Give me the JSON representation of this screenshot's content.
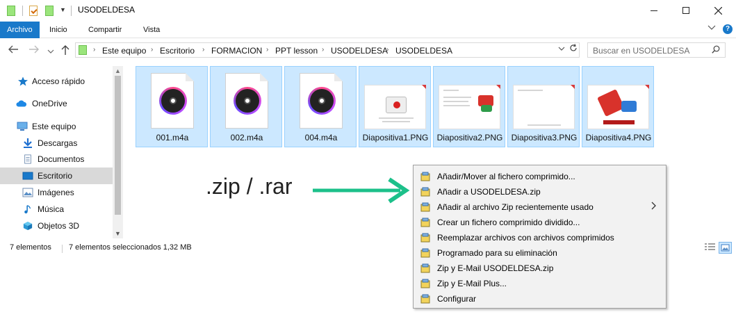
{
  "window": {
    "title": "USODELDESA",
    "quick_access": [
      "folder-icon",
      "properties-icon",
      "new-folder-icon"
    ]
  },
  "ribbon": {
    "tabs": [
      {
        "label": "Archivo",
        "active": true
      },
      {
        "label": "Inicio"
      },
      {
        "label": "Compartir"
      },
      {
        "label": "Vista"
      }
    ]
  },
  "address": {
    "crumbs": [
      "Este equipo",
      "Escritorio",
      "FORMACION",
      "PPT lesson",
      "USODELDESA",
      "USODELDESA"
    ]
  },
  "search": {
    "placeholder": "Buscar en USODELDESA"
  },
  "sidebar": {
    "items": [
      {
        "label": "Acceso rápido",
        "icon": "star-icon"
      },
      {
        "label": "OneDrive",
        "icon": "cloud-icon"
      },
      {
        "label": "Este equipo",
        "icon": "computer-icon"
      },
      {
        "label": "Descargas",
        "icon": "download-icon"
      },
      {
        "label": "Documentos",
        "icon": "documents-icon"
      },
      {
        "label": "Escritorio",
        "icon": "desktop-icon",
        "selected": true
      },
      {
        "label": "Imágenes",
        "icon": "images-icon"
      },
      {
        "label": "Música",
        "icon": "music-icon"
      },
      {
        "label": "Objetos 3D",
        "icon": "cube-icon"
      }
    ]
  },
  "files": [
    {
      "name": "001.m4a",
      "type": "audio"
    },
    {
      "name": "002.m4a",
      "type": "audio"
    },
    {
      "name": "004.m4a",
      "type": "audio"
    },
    {
      "name": "Diapositiva1.PNG",
      "type": "image"
    },
    {
      "name": "Diapositiva2.PNG",
      "type": "image"
    },
    {
      "name": "Diapositiva3.PNG",
      "type": "image"
    },
    {
      "name": "Diapositiva4.PNG",
      "type": "image"
    }
  ],
  "status": {
    "count": "7 elementos",
    "selected": "7 elementos seleccionados  1,32 MB"
  },
  "annotation": {
    "text": ".zip / .rar",
    "arrow_color": "#1cc08a"
  },
  "context_menu": {
    "items": [
      {
        "label": "Añadir/Mover al fichero comprimido..."
      },
      {
        "label": "Añadir a USODELDESA.zip"
      },
      {
        "label": "Añadir al archivo Zip recientemente usado",
        "submenu": true
      },
      {
        "label": "Crear un fichero comprimido dividido..."
      },
      {
        "label": "Reemplazar archivos con archivos comprimidos"
      },
      {
        "label": "Programado para su eliminación"
      },
      {
        "label": "Zip y E-Mail USODELDESA.zip"
      },
      {
        "label": "Zip y E-Mail Plus..."
      },
      {
        "label": "Configurar"
      }
    ]
  },
  "colors": {
    "accent": "#1979ca",
    "selection": "#cce8ff",
    "folder": "#9be57c"
  }
}
